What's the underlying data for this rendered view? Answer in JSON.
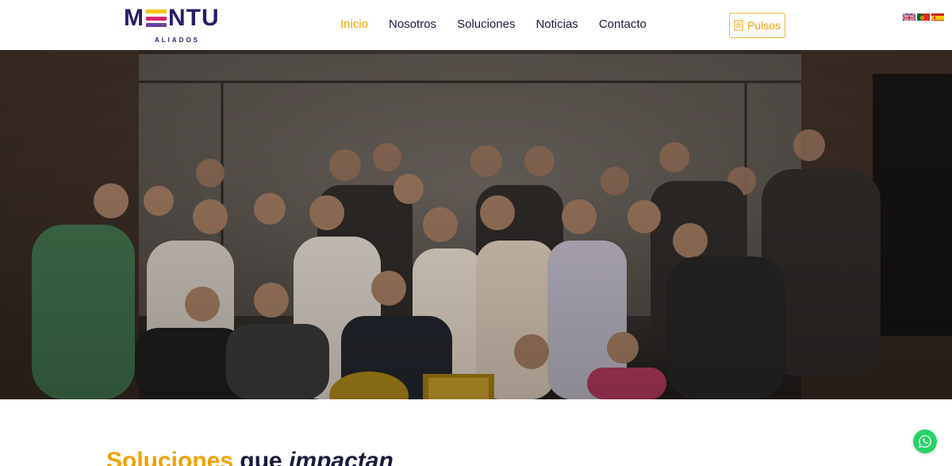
{
  "brand": {
    "name_left": "M",
    "name_right": "NTU",
    "tagline": "ALIADOS",
    "colors": {
      "navy": "#2b1b6b",
      "orange": "#f0a100",
      "yellow": "#f7c600",
      "magenta": "#d6246e",
      "purple": "#6b3fa0"
    }
  },
  "nav": {
    "items": [
      {
        "label": "Inicio",
        "active": true
      },
      {
        "label": "Nosotros",
        "active": false
      },
      {
        "label": "Soluciones",
        "active": false
      },
      {
        "label": "Noticias",
        "active": false
      },
      {
        "label": "Contacto",
        "active": false
      }
    ]
  },
  "header_button": {
    "label": "Pulsos",
    "icon": "document-icon"
  },
  "languages": [
    {
      "code": "en",
      "icon": "uk-flag-icon"
    },
    {
      "code": "pt",
      "icon": "portugal-flag-icon"
    },
    {
      "code": "es",
      "icon": "spain-flag-icon"
    }
  ],
  "hero": {
    "image": "team-group-photo"
  },
  "section": {
    "title_accent": "Soluciones",
    "title_middle": " que ",
    "title_emphasis": "impactan"
  },
  "floating": {
    "icon": "whatsapp-icon"
  }
}
